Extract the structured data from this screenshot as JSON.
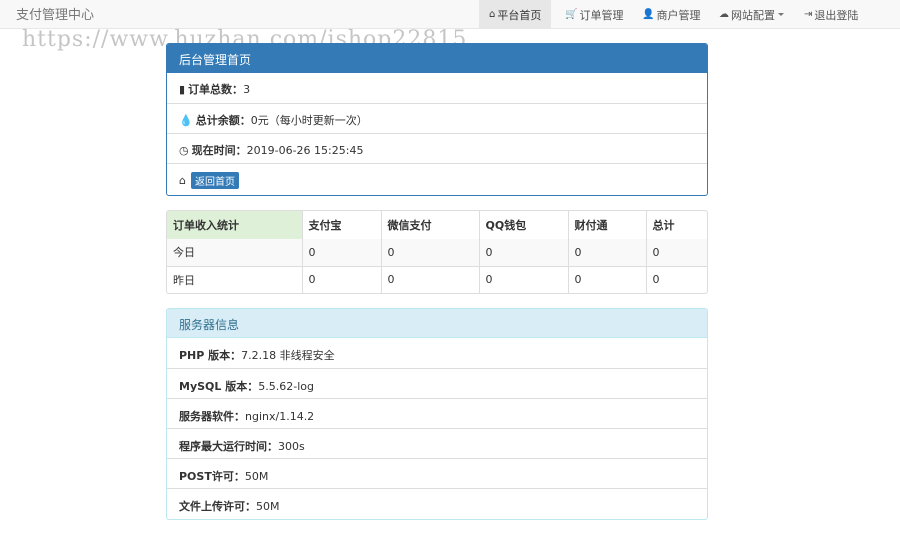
{
  "navbar": {
    "brand": "支付管理中心",
    "items": [
      {
        "icon": "home-icon",
        "glyph": "⌂",
        "label": "平台首页"
      },
      {
        "icon": "cart-icon",
        "glyph": "🛒",
        "label": "订单管理"
      },
      {
        "icon": "user-icon",
        "glyph": "👤",
        "label": "商户管理"
      },
      {
        "icon": "cloud-icon",
        "glyph": "☁",
        "label": "网站配置"
      },
      {
        "icon": "logout-icon",
        "glyph": "⇥",
        "label": "退出登陆"
      }
    ]
  },
  "watermark": "https://www.huzhan.com/ishop22815",
  "admin_panel": {
    "title": "后台管理首页",
    "order_total_label": "订单总数：",
    "order_total_value": "3",
    "balance_label": "总计余额：",
    "balance_value": "0元（每小时更新一次）",
    "time_label": "现在时间：",
    "time_value": "2019-06-26 15:25:45",
    "home_button": "返回首页"
  },
  "stats_table": {
    "headers": [
      "订单收入统计",
      "支付宝",
      "微信支付",
      "QQ钱包",
      "财付通",
      "总计"
    ],
    "rows": [
      [
        "今日",
        "0",
        "0",
        "0",
        "0",
        "0"
      ],
      [
        "昨日",
        "0",
        "0",
        "0",
        "0",
        "0"
      ]
    ]
  },
  "server_panel": {
    "title": "服务器信息",
    "rows": [
      {
        "label": "PHP 版本：",
        "value": "7.2.18 非线程安全"
      },
      {
        "label": "MySQL 版本：",
        "value": "5.5.62-log"
      },
      {
        "label": "服务器软件：",
        "value": "nginx/1.14.2"
      },
      {
        "label": "程序最大运行时间：",
        "value": "300s"
      },
      {
        "label": "POST许可：",
        "value": "50M"
      },
      {
        "label": "文件上传许可：",
        "value": "50M"
      }
    ]
  },
  "colors": {
    "primary": "#337ab7",
    "info_bg": "#d9edf7",
    "info_text": "#31708f",
    "success_bg": "#dff0d8"
  }
}
